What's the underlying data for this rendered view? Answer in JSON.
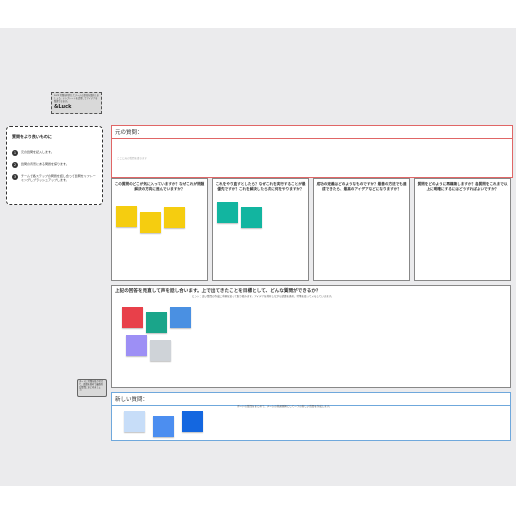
{
  "logo_card": {
    "text": "Luck 付箋を利用してチームの意見を集約しましょう。テンプレートを活用してアイデアを整理できます。",
    "brand": "&Luck"
  },
  "help": {
    "title": "質問をより良いものに",
    "steps": [
      {
        "n": "1",
        "text": "元の質問を記入します。"
      },
      {
        "n": "2",
        "text": "質問の背景にある問題を探ります。"
      },
      {
        "n": "3",
        "text": "チームで各ステップの問題を話し合って質問をリフレーミングしブラッシュアップします。"
      }
    ]
  },
  "original": {
    "title": "元の質問：",
    "placeholder": "ここに元の質問を書きます"
  },
  "questions": [
    {
      "label": "この質問のどこが気に入っていますか？なぜこれが問題解決の方向に進んでいますか？"
    },
    {
      "label": "これをやり直すとしたら？なぜこれを実行することが最優先ですか？これを解決したら次に何をやりますか？"
    },
    {
      "label": "成功の定義はどのようなものですか？最善の方法でも達成できたら、最高のアイデアなどになりますか？"
    },
    {
      "label": "質問をどのように再構築しますか？各質問をこれまで以上に明確にするにはどうすればよいですか？"
    }
  ],
  "goal": {
    "title": "上記の回答を見直して声を話し合います。上で出てきたことを目標として、どんな質問ができるか？",
    "subtitle": "ヒント：良い質問の作成に手順を追って取り組みます。アイデアを共有しながら議論を進め、付箋を使ってメモしていきます。"
  },
  "new_question": {
    "title": "新しい質問：",
    "subtitle": "ボードの質問をまとめて、チームの共通理解として一つの新しい質問を作成します。"
  },
  "callout": {
    "text": "ボードに付箋を貼り付けて、議論を進めて最終的な質問にまとめましょう。"
  },
  "colors": {
    "yellow": "#f5cd10",
    "teal": "#12b5a0",
    "red": "#e8404a",
    "green": "#1aa58a",
    "blue": "#4a90e2",
    "purple": "#9d8ff5",
    "gray": "#cfd3d8",
    "light_blue": "#c7ddf8",
    "mid_blue": "#4c8ef0",
    "dark_blue": "#1467e0"
  }
}
